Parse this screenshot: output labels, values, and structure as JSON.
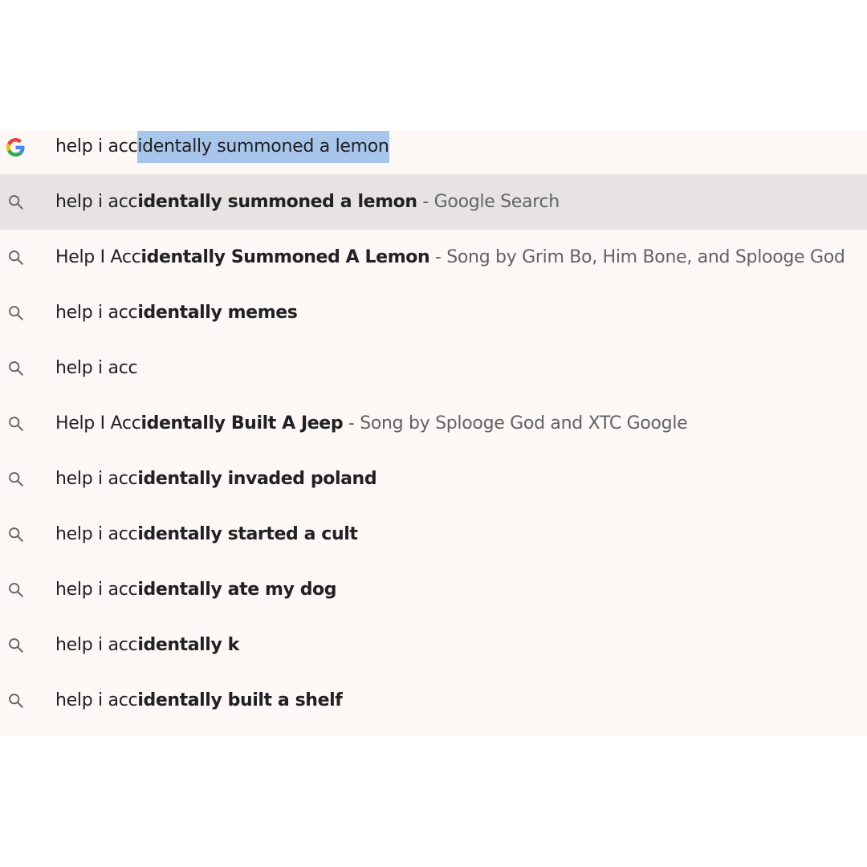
{
  "omnibox": {
    "typed": "help i acc",
    "selected_completion": "identally summoned a lemon",
    "icon": "google-g-icon"
  },
  "suggestions": [
    {
      "prefix": "help i acc",
      "match": "identally summoned a lemon",
      "separator": " - ",
      "description": "Google Search",
      "selected": true
    },
    {
      "prefix": "Help I Acc",
      "match": "identally Summoned A Lemon",
      "separator": " - ",
      "description": "Song by Grim Bo, Him Bone, and Splooge God"
    },
    {
      "prefix": "help i acc",
      "match": "identally memes"
    },
    {
      "prefix": "help i acc",
      "match": ""
    },
    {
      "prefix": "Help I Acc",
      "match": "identally Built A Jeep",
      "separator": " - ",
      "description": "Song by Splooge God and XTC Google"
    },
    {
      "prefix": "help i acc",
      "match": "identally invaded poland"
    },
    {
      "prefix": "help i acc",
      "match": "identally started a cult"
    },
    {
      "prefix": "help i acc",
      "match": "identally ate my dog"
    },
    {
      "prefix": "help i acc",
      "match": "identally k"
    },
    {
      "prefix": "help i acc",
      "match": "identally built a shelf"
    }
  ],
  "icons": {
    "suggestion": "search-icon"
  },
  "colors": {
    "dropdown_bg": "#fdf7f5",
    "selected_row_bg": "#e8e3e3",
    "selection_highlight": "#a8c6ec",
    "text": "#202124",
    "secondary_text": "#5f6368"
  }
}
